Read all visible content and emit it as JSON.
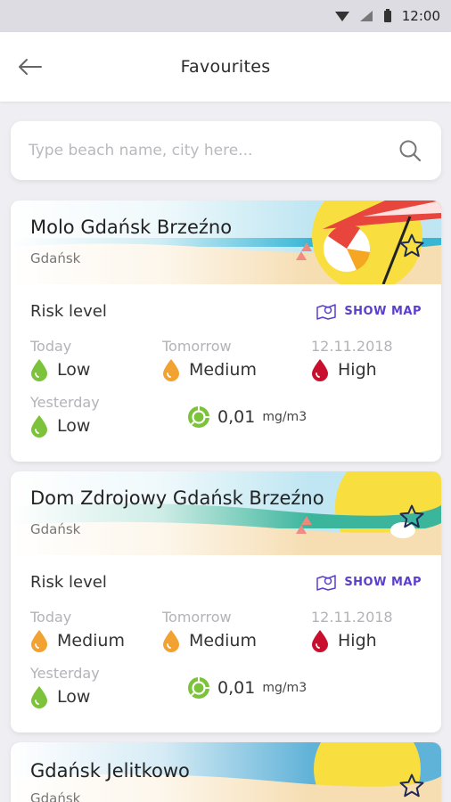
{
  "status_bar": {
    "time": "12:00"
  },
  "app_bar": {
    "title": "Favourites"
  },
  "search": {
    "placeholder": "Type beach name, city here..."
  },
  "cards": [
    {
      "name": "Molo Gdańsk Brzeźno",
      "city": "Gdańsk",
      "risk_label": "Risk level",
      "show_map": "SHOW MAP",
      "today_label": "Today",
      "today_value": "Low",
      "tomorrow_label": "Tomorrow",
      "tomorrow_value": "Medium",
      "date_label": "12.11.2018",
      "date_value": "High",
      "yesterday_label": "Yesterday",
      "yesterday_value": "Low",
      "concentration": "0,01",
      "unit": "mg/m3"
    },
    {
      "name": "Dom Zdrojowy Gdańsk Brzeźno",
      "city": "Gdańsk",
      "risk_label": "Risk level",
      "show_map": "SHOW MAP",
      "today_label": "Today",
      "today_value": "Medium",
      "tomorrow_label": "Tomorrow",
      "tomorrow_value": "Medium",
      "date_label": "12.11.2018",
      "date_value": "High",
      "yesterday_label": "Yesterday",
      "yesterday_value": "Low",
      "concentration": "0,01",
      "unit": "mg/m3"
    },
    {
      "name": "Gdańsk Jelitkowo",
      "city": "Gdańsk"
    }
  ],
  "colors": {
    "low": "#7cc23a",
    "medium": "#f2a230",
    "high": "#c8102e",
    "accent": "#5b3fcc"
  }
}
